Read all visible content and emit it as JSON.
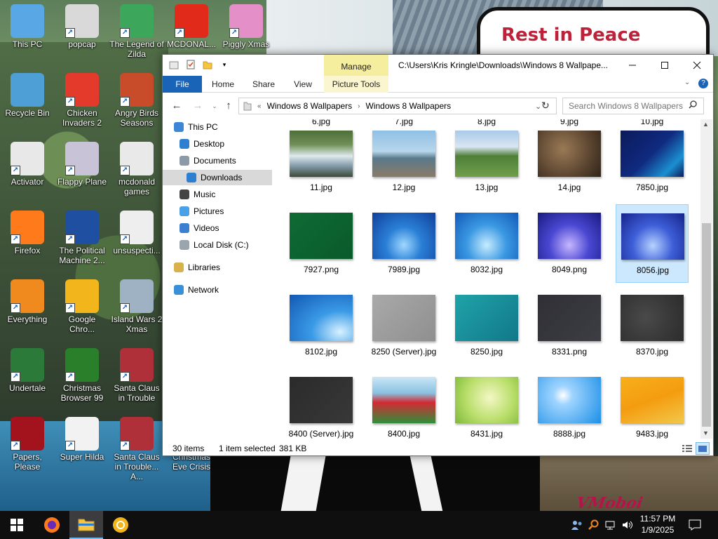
{
  "desktop": {
    "background_text": "Rest in Peace",
    "watermark": "VMoboi",
    "icons": [
      {
        "label": "This PC",
        "color": "#5aa7e6"
      },
      {
        "label": "Recycle Bin",
        "color": "#4d9fd6"
      },
      {
        "label": "Activator",
        "color": "#e8e8e8"
      },
      {
        "label": "Firefox",
        "color": "#ff7a1a"
      },
      {
        "label": "Everything",
        "color": "#f08a1e"
      },
      {
        "label": "Undertale",
        "color": "#2c7a3a"
      },
      {
        "label": "Papers, Please",
        "color": "#a3131d"
      },
      {
        "label": "popcap",
        "color": "#d9d9d9"
      },
      {
        "label": "Chicken Invaders 2",
        "color": "#e43a2b"
      },
      {
        "label": "Flappy Plane",
        "color": "#c9c3d8"
      },
      {
        "label": "The Political Machine 2...",
        "color": "#1e4fa0"
      },
      {
        "label": "Google Chro...",
        "color": "#f2b51c"
      },
      {
        "label": "Christmas Browser 99",
        "color": "#2a7f2a"
      },
      {
        "label": "Super Hilda",
        "color": "#f2f2f2"
      },
      {
        "label": "The Legend of Zilda",
        "color": "#3ca65a"
      },
      {
        "label": "Angry Birds Seasons",
        "color": "#c84b2a"
      },
      {
        "label": "mcdonald games",
        "color": "#e9e9e9"
      },
      {
        "label": "unsuspecti...",
        "color": "#eeeeee"
      },
      {
        "label": "Island Wars 2 Xmas",
        "color": "#9fb2c4"
      },
      {
        "label": "Santa Claus in Trouble",
        "color": "#b0303a"
      },
      {
        "label": "Santa Claus in Trouble... A...",
        "color": "#b0303a"
      },
      {
        "label": "MCDONAL...",
        "color": "#e22a1a"
      },
      {
        "label": "Piggly Xmas",
        "color": "#e58fc9"
      },
      {
        "label": "Christmas Eve Crisis",
        "color": "#333333"
      }
    ]
  },
  "window": {
    "title": "C:\\Users\\Kris Kringle\\Downloads\\Windows 8 Wallpape...",
    "manage_tab": "Manage",
    "ribbon_tabs": [
      "File",
      "Home",
      "Share",
      "View",
      "Picture Tools"
    ],
    "breadcrumb": [
      "Windows 8 Wallpapers",
      "Windows 8 Wallpapers"
    ],
    "breadcrumb_prefix": "«",
    "search_placeholder": "Search Windows 8 Wallpapers",
    "nav": [
      {
        "label": "This PC",
        "icon": "#3b86d6",
        "level": 0
      },
      {
        "label": "Desktop",
        "icon": "#2f7fd1",
        "level": 1
      },
      {
        "label": "Documents",
        "icon": "#8c9aa8",
        "level": 1
      },
      {
        "label": "Downloads",
        "icon": "#2f7fd1",
        "level": 1,
        "selected": true
      },
      {
        "label": "Music",
        "icon": "#444444",
        "level": 1
      },
      {
        "label": "Pictures",
        "icon": "#4aa0e6",
        "level": 1
      },
      {
        "label": "Videos",
        "icon": "#3a7fd0",
        "level": 1
      },
      {
        "label": "Local Disk (C:)",
        "icon": "#9aa4ad",
        "level": 1
      },
      {
        "label": "Libraries",
        "icon": "#d7b24a",
        "level": 0
      },
      {
        "label": "Network",
        "icon": "#3a90d6",
        "level": 0
      }
    ],
    "top_labels": [
      "6.jpg",
      "7.jpg",
      "8.jpg",
      "9.jpg",
      "10.jpg"
    ],
    "files": [
      {
        "name": "11.jpg",
        "bg": "linear-gradient(180deg,#4f6f3a 0%,#6f8f55 30%,#dfe9ee 55%,#88a0ad 75%,#3b4a3a 100%)"
      },
      {
        "name": "12.jpg",
        "bg": "linear-gradient(180deg,#8fc0e6 0%,#b8d6ec 45%,#5a7a8a 60%,#8a7a68 100%)"
      },
      {
        "name": "13.jpg",
        "bg": "linear-gradient(180deg,#a9c9e8 0%,#d9e6f2 35%,#4f7f3a 55%,#6f9f4a 100%)"
      },
      {
        "name": "14.jpg",
        "bg": "radial-gradient(circle at 40% 40%,#9a7a55 0,#5a4430 60%,#2e2418 100%)"
      },
      {
        "name": "7850.jpg",
        "bg": "linear-gradient(135deg,#0c1a5a 0%,#102a80 50%,#1b8fd0 80%,#0c1a5a 100%)"
      },
      {
        "name": "7927.png",
        "bg": "linear-gradient(135deg,#0e6b34,#0a5a2a)"
      },
      {
        "name": "7989.jpg",
        "bg": "radial-gradient(ellipse at 50% 70%,#9fd8ff 0,#2a7fd6 40%,#103f9a 100%)"
      },
      {
        "name": "8032.jpg",
        "bg": "radial-gradient(ellipse at 50% 70%,#c6ecff 0,#3a98e2 45%,#1259b8 100%)"
      },
      {
        "name": "8049.png",
        "bg": "radial-gradient(ellipse at 50% 70%,#c7b6ff 0,#4a48d2 45%,#1a1a80 100%)"
      },
      {
        "name": "8056.jpg",
        "bg": "radial-gradient(ellipse at 50% 70%,#b6d2ff 0,#3e5fd8 45%,#15238a 100%)",
        "selected": true
      },
      {
        "name": "8102.jpg",
        "bg": "radial-gradient(ellipse at 80% 80%,#d8f2ff 0,#3a9ae6 40%,#1257b4 100%)"
      },
      {
        "name": "8250 (Server).jpg",
        "bg": "linear-gradient(135deg,#a9a9a9,#8f8f8f)"
      },
      {
        "name": "8250.jpg",
        "bg": "linear-gradient(135deg,#1fa3a8,#12788a)"
      },
      {
        "name": "8331.png",
        "bg": "linear-gradient(135deg,#2f2f35,#3d3d44)"
      },
      {
        "name": "8370.jpg",
        "bg": "radial-gradient(circle at 40% 50%,#4a4a4a 0,#3a3a3a 50%,#2c2c2c 100%)"
      },
      {
        "name": "8400 (Server).jpg",
        "bg": "linear-gradient(135deg,#2b2b2b,#383838)"
      },
      {
        "name": "8400.jpg",
        "bg": "linear-gradient(180deg,#cbe7f7 0%,#89c1e0 35%,#d42a34 55%,#2f8f3a 100%)"
      },
      {
        "name": "8431.jpg",
        "bg": "radial-gradient(circle at 55% 45%,#f4f7c4 0,#b8de6a 55%,#7fb83a 100%)"
      },
      {
        "name": "8888.jpg",
        "bg": "radial-gradient(circle at 40% 40%,#ffffff 0,#9fd4ff 20%,#1c8fe6 100%)"
      },
      {
        "name": "9483.jpg",
        "bg": "linear-gradient(160deg,#f7b01a 0%,#f49c10 50%,#f2c84a 100%)"
      }
    ],
    "status": {
      "count": "30 items",
      "selection": "1 item selected",
      "size": "381 KB"
    }
  },
  "taskbar": {
    "time": "11:57 PM",
    "date": "1/9/2025"
  }
}
